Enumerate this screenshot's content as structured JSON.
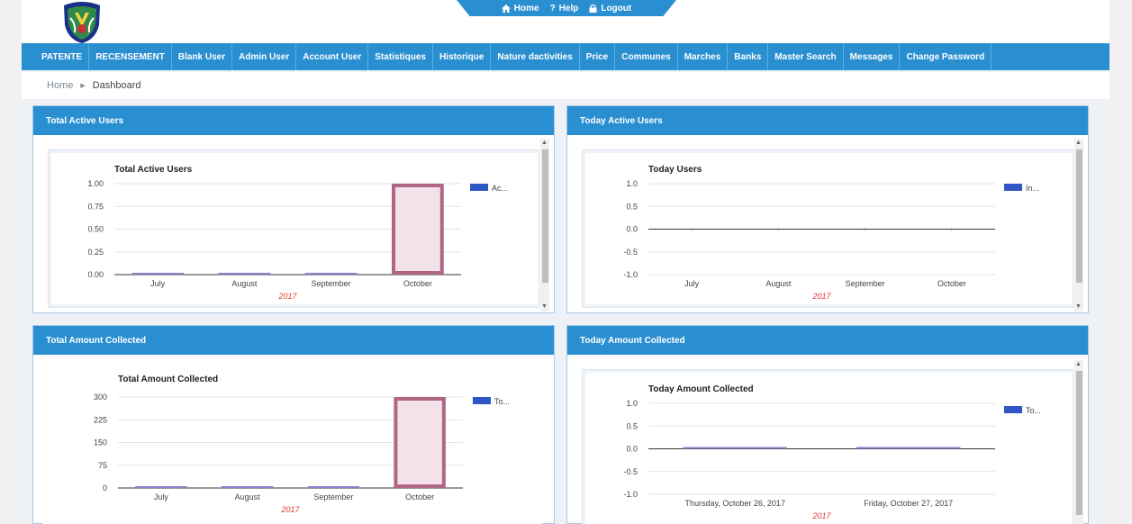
{
  "colors": {
    "nav": "#2a8fd0",
    "bar_fill": "#f4e2ea",
    "bar_stroke": "#b06685",
    "legend": "#3056c6",
    "year": "#e53935"
  },
  "toplinks": [
    {
      "icon": "home-icon",
      "label": "Home"
    },
    {
      "icon": "help-icon",
      "label": "Help"
    },
    {
      "icon": "lock-icon",
      "label": "Logout"
    }
  ],
  "nav": [
    "PATENTE",
    "RECENSEMENT",
    "Blank User",
    "Admin User",
    "Account User",
    "Statistiques",
    "Historique",
    "Nature dactivities",
    "Price",
    "Communes",
    "Marches",
    "Banks",
    "Master Search",
    "Messages",
    "Change Password"
  ],
  "breadcrumb": {
    "home": "Home",
    "current": "Dashboard"
  },
  "panels": [
    {
      "header": "Total Active Users",
      "chart_data": {
        "type": "bar",
        "title": "Total Active Users",
        "categories": [
          "July",
          "August",
          "September",
          "October"
        ],
        "values": [
          0,
          0,
          0,
          1
        ],
        "ylim": [
          0,
          1
        ],
        "yticks": [
          "1.00",
          "0.75",
          "0.50",
          "0.25",
          "0.00"
        ],
        "year": "2017",
        "legend": "Ac..."
      }
    },
    {
      "header": "Today Active Users",
      "chart_data": {
        "type": "line",
        "title": "Today Users",
        "categories": [
          "July",
          "August",
          "September",
          "October"
        ],
        "values": [
          0,
          0,
          0,
          0
        ],
        "ylim": [
          -1,
          1
        ],
        "yticks": [
          "1.0",
          "0.5",
          "0.0",
          "-0.5",
          "-1.0"
        ],
        "year": "2017",
        "legend": "In..."
      }
    },
    {
      "header": "Total Amount Collected",
      "chart_data": {
        "type": "bar",
        "title": "Total Amount Collected",
        "categories": [
          "July",
          "August",
          "September",
          "October"
        ],
        "values": [
          0,
          0,
          0,
          300
        ],
        "ylim": [
          0,
          300
        ],
        "yticks": [
          "300",
          "225",
          "150",
          "75",
          "0"
        ],
        "year": "2017",
        "legend": "To..."
      }
    },
    {
      "header": "Today Amount Collected",
      "chart_data": {
        "type": "bar",
        "title": "Today Amount Collected",
        "categories": [
          "Thursday, October 26, 2017",
          "Friday, October 27, 2017"
        ],
        "values": [
          0,
          0
        ],
        "ylim": [
          -1,
          1
        ],
        "yticks": [
          "1.0",
          "0.5",
          "0.0",
          "-0.5",
          "-1.0"
        ],
        "year": "2017",
        "legend": "To..."
      }
    }
  ]
}
